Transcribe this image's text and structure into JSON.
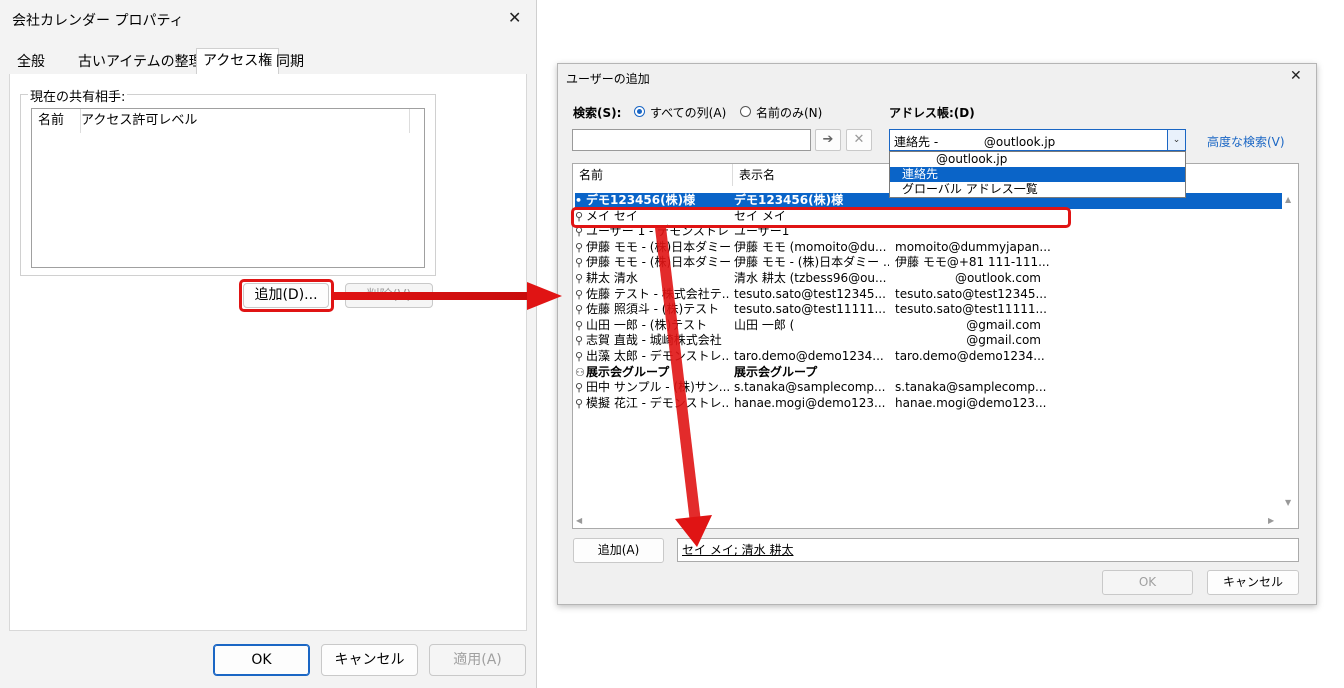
{
  "left_dialog": {
    "title": "会社カレンダー プロパティ",
    "tabs": [
      "全般",
      "古いアイテムの整理",
      "アクセス権",
      "同期"
    ],
    "group_label": "現在の共有相手:",
    "list_headers": [
      "名前",
      "アクセス許可レベル"
    ],
    "add_button": "追加(D)...",
    "remove_button": "削除(V)",
    "ok_button": "OK",
    "cancel_button": "キャンセル",
    "apply_button": "適用(A)"
  },
  "right_dialog": {
    "title": "ユーザーの追加",
    "search_label": "検索(S):",
    "radio_all": "すべての列(A)",
    "radio_name": "名前のみ(N)",
    "address_book_label": "アドレス帳:(D)",
    "address_book_value": "連絡先 -            @outlook.jp",
    "advanced_search": "高度な検索(V)",
    "search_value": "",
    "dropdown_options": [
      "@outlook.jp",
      "連絡先",
      "グローバル アドレス一覧"
    ],
    "selected_option_index": 1,
    "columns": [
      "名前",
      "表示名"
    ],
    "rows": [
      {
        "name": "デモ123456(株)様",
        "display": "デモ123456(株)様",
        "email": "",
        "type": "contact",
        "bold": true,
        "selected": true
      },
      {
        "name": "メイ セイ",
        "display": "セイ メイ",
        "email": "",
        "type": "person"
      },
      {
        "name": "ユーザー 1 - デモンストレ...",
        "display": "ユーザー1",
        "email": "",
        "type": "person"
      },
      {
        "name": "伊藤 モモ - (株)日本ダミー",
        "display": "伊藤 モモ (momoito@du...",
        "email": "momoito@dummyjapan...",
        "type": "person"
      },
      {
        "name": "伊藤 モモ - (株)日本ダミー",
        "display": "伊藤 モモ - (株)日本ダミー ...",
        "email": "伊藤 モモ@+81 111-111...",
        "type": "person"
      },
      {
        "name": "耕太 清水",
        "display": "清水 耕太 (tzbess96@ou...",
        "email": "@outlook.com",
        "type": "person"
      },
      {
        "name": "佐藤 テスト - 株式会社テ...",
        "display": "tesuto.sato@test12345...",
        "email": "tesuto.sato@test12345...",
        "type": "person"
      },
      {
        "name": "佐藤 照須斗 - (株)テスト",
        "display": "tesuto.sato@test11111...",
        "email": "tesuto.sato@test11111...",
        "type": "person"
      },
      {
        "name": "山田 一郎 - (株)テスト",
        "display": "山田 一郎 (",
        "email": "@gmail.com",
        "type": "person"
      },
      {
        "name": "志賀 直哉 - 城崎株式会社",
        "display": "",
        "email": "@gmail.com",
        "type": "person"
      },
      {
        "name": "出藻 太郎 - デモンストレ...",
        "display": "taro.demo@demo1234...",
        "email": "taro.demo@demo1234...",
        "type": "person"
      },
      {
        "name": "展示会グループ",
        "display": "展示会グループ",
        "email": "",
        "type": "group",
        "bold": true
      },
      {
        "name": "田中 サンプル - (株)サン...",
        "display": "s.tanaka@samplecomp...",
        "email": "s.tanaka@samplecomp...",
        "type": "person"
      },
      {
        "name": "模擬 花江 - デモンストレ...",
        "display": "hanae.mogi@demo123...",
        "email": "hanae.mogi@demo123...",
        "type": "person"
      }
    ],
    "add_button": "追加(A)",
    "added_users": "セイ メイ; 清水 耕太",
    "ok_button": "OK",
    "cancel_button": "キャンセル"
  },
  "colors": {
    "highlight_red": "#e01414",
    "selection_blue": "#0a64c8",
    "link_blue": "#1a66c4"
  }
}
